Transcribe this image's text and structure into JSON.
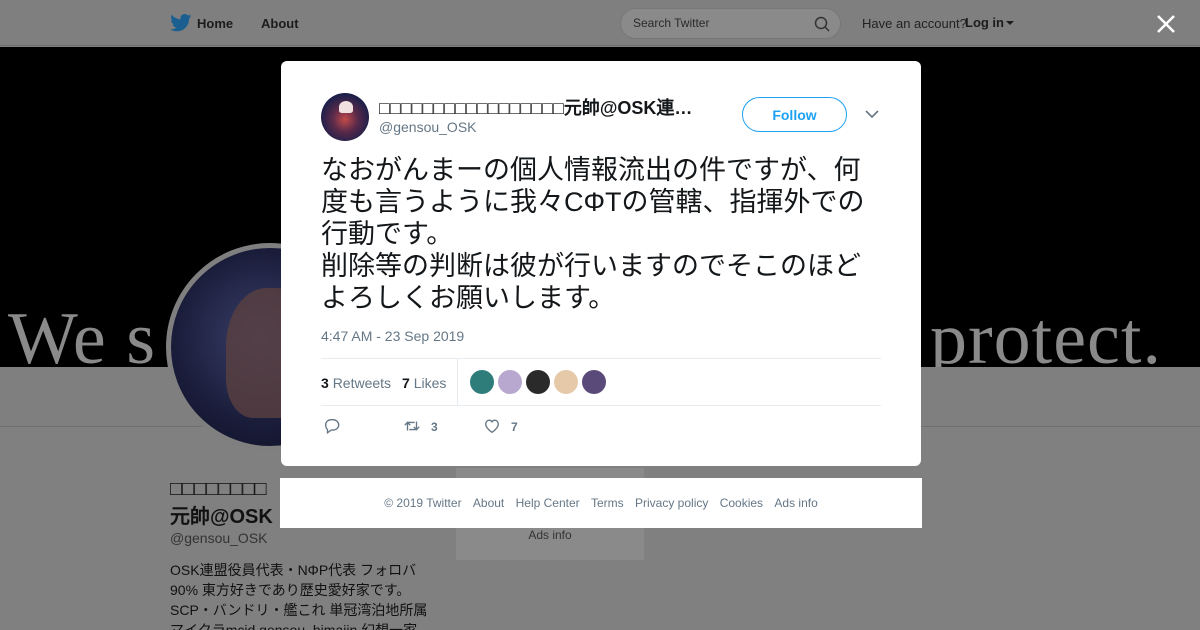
{
  "nav": {
    "home": "Home",
    "about": "About",
    "search_placeholder": "Search Twitter",
    "have_account": "Have an account?",
    "login": "Log in"
  },
  "banner": {
    "text_left": "We s",
    "text_right": "protect."
  },
  "profile": {
    "name_line1": "□□□□□□□□",
    "name_line2": "元帥@OSK",
    "handle": "@gensou_OSK",
    "bio_lines": [
      "OSK連盟役員代表・NΦP代表 フォロバ",
      "90% 東方好きであり歴史愛好家です。",
      "SCP・バンドリ・艦これ 単冠湾泊地所属",
      "マイクラmcid gensou_himajin 幻想一家"
    ],
    "side_card_ads": "Ads info"
  },
  "tweet": {
    "author_name": "□□□□□□□□□□□□□□□□□元帥@OSK連盟役員代表",
    "author_handle": "@gensou_OSK",
    "follow_label": "Follow",
    "text": "なおがんまーの個人情報流出の件ですが、何度も言うように我々CΦTの管轄、指揮外での行動です。\n削除等の判断は彼が行いますのでそこのほどよろしくお願いします。",
    "timestamp": "4:47 AM - 23 Sep 2019",
    "retweets_count": "3",
    "retweets_label": "Retweets",
    "likes_count": "7",
    "likes_label": "Likes",
    "reply_count": "",
    "retweet_action_count": "3",
    "like_action_count": "7"
  },
  "likers": [
    {
      "name": "liker-1",
      "color": "#2f7d7a"
    },
    {
      "name": "liker-2",
      "color": "#b8a8d0"
    },
    {
      "name": "liker-3",
      "color": "#2a2a2a"
    },
    {
      "name": "liker-4",
      "color": "#e6c9a8"
    },
    {
      "name": "liker-5",
      "color": "#5a4a7a"
    }
  ],
  "footer": {
    "copyright": "© 2019 Twitter",
    "about": "About",
    "help": "Help Center",
    "terms": "Terms",
    "privacy": "Privacy policy",
    "cookies": "Cookies",
    "ads": "Ads info"
  },
  "colors": {
    "accent": "#1da1f2",
    "overlay": "#808080",
    "muted_text": "#657786"
  }
}
